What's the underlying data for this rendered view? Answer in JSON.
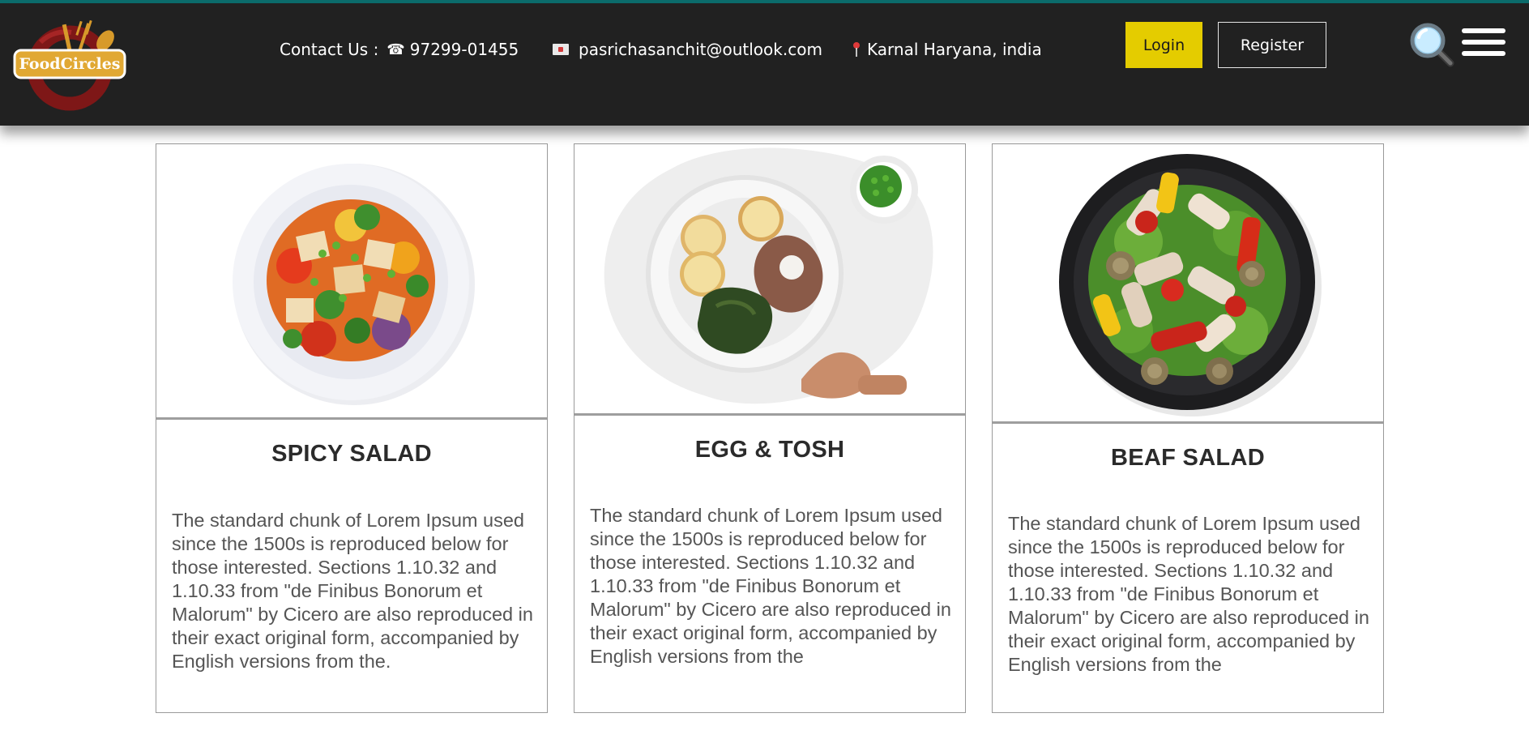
{
  "header": {
    "logo_text": "FoodCircles",
    "contact_label": "Contact Us :",
    "phone": "97299-01455",
    "email": "pasrichasanchit@outlook.com",
    "location": "Karnal Haryana, india",
    "login_label": "Login",
    "register_label": "Register",
    "icons": {
      "phone": "phone-icon",
      "email": "envelope-icon",
      "location": "pin-icon",
      "search": "search-icon",
      "menu": "hamburger-menu-icon"
    }
  },
  "colors": {
    "header_bg": "#212121",
    "header_top_border": "#0b6b6b",
    "login_bg": "#e4cc00",
    "logo_ring": "#8b1a1a",
    "logo_badge": "#e1a833"
  },
  "cards": [
    {
      "title": "SPICY SALAD",
      "image": "plate-of-vegetable-salad-with-tofu",
      "description": "The standard chunk of Lorem Ipsum used since the 1500s is reproduced below for those interested. Sections 1.10.32 and 1.10.33 from \"de Finibus Bonorum et Malorum\" by Cicero are also reproduced in their exact original form, accompanied by English versions from the."
    },
    {
      "title": "EGG & TOSH",
      "image": "plate-with-potatoes-steak-and-spinach",
      "description": "The standard chunk of Lorem Ipsum used since the 1500s is reproduced below for those interested. Sections 1.10.32 and 1.10.33 from \"de Finibus Bonorum et Malorum\" by Cicero are also reproduced in their exact original form, accompanied by English versions from the"
    },
    {
      "title": "BEAF SALAD",
      "image": "dark-plate-with-grilled-chicken-salad",
      "description": "The standard chunk of Lorem Ipsum used since the 1500s is reproduced below for those interested. Sections 1.10.32 and 1.10.33 from \"de Finibus Bonorum et Malorum\" by Cicero are also reproduced in their exact original form, accompanied by English versions from the"
    }
  ]
}
